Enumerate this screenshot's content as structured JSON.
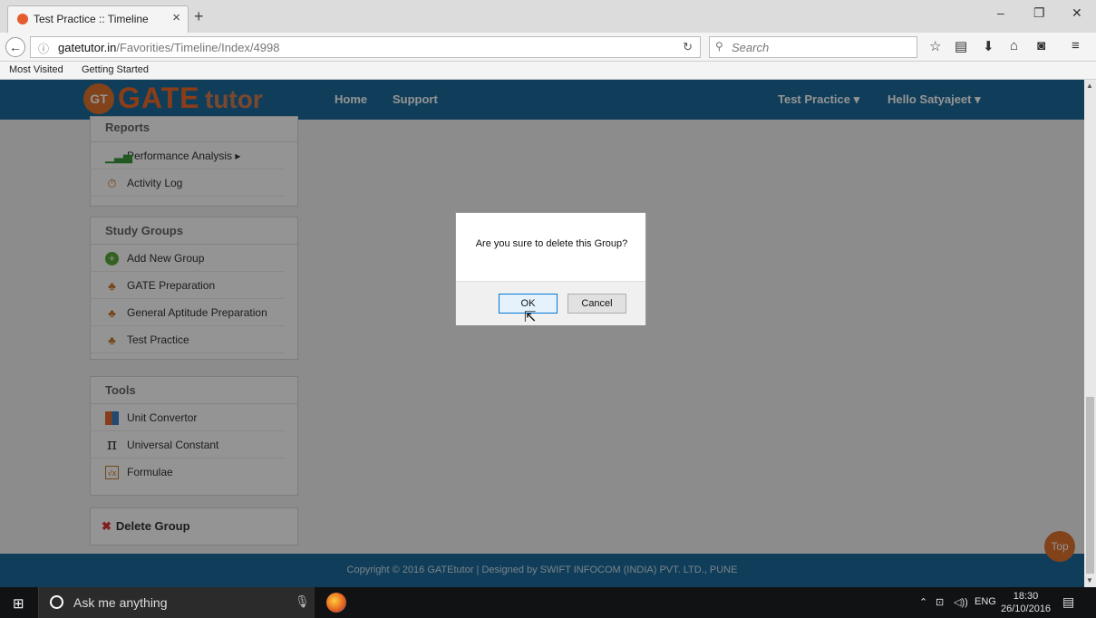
{
  "browser": {
    "tab_title": "Test Practice :: Timeline",
    "url_domain": "gatetutor.in",
    "url_path": "/Favorities/Timeline/Index/4998",
    "search_placeholder": "Search",
    "bookmarks": [
      "Most Visited",
      "Getting Started"
    ]
  },
  "header": {
    "logo_badge": "GT",
    "logo_gate": "GATE",
    "logo_tutor": "tutor",
    "nav": [
      "Home",
      "Support"
    ],
    "test_practice": "Test Practice ▾",
    "user": "Hello Satyajeet ▾"
  },
  "sidebar": {
    "reports": {
      "title": "Reports",
      "items": [
        "Performance Analysis ▸",
        "Activity Log"
      ]
    },
    "study_groups": {
      "title": "Study Groups",
      "items": [
        "Add New Group",
        "GATE Preparation",
        "General Aptitude Preparation",
        "Test Practice"
      ]
    },
    "tools": {
      "title": "Tools",
      "items": [
        "Unit Convertor",
        "Universal Constant",
        "Formulae"
      ]
    },
    "delete_group": "Delete Group"
  },
  "dialog": {
    "message": "Are you sure to delete this Group?",
    "ok": "OK",
    "cancel": "Cancel"
  },
  "footer": {
    "copyright": "Copyright © 2016 GATEtutor | Designed by SWIFT INFOCOM (INDIA) PVT. LTD., PUNE",
    "top_button": "Top"
  },
  "taskbar": {
    "search_placeholder": "Ask me anything",
    "language": "ENG",
    "time": "18:30",
    "date": "26/10/2016"
  },
  "colors": {
    "header_blue": "#1d6b9c",
    "accent_orange": "#e0732d"
  }
}
